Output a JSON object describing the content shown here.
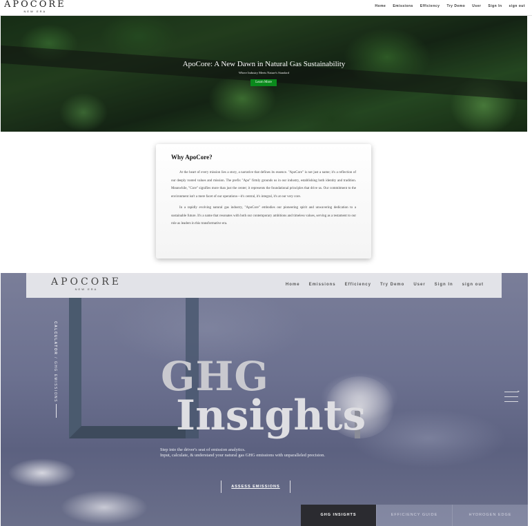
{
  "topnav": {
    "logo_main": "APOCORE",
    "logo_sub": "NEW ERA",
    "links": [
      "Home",
      "Emissions",
      "Efficiency",
      "Try Demo",
      "User",
      "Sign In",
      "sign out"
    ]
  },
  "hero": {
    "title": "ApoCore: A New Dawn in Natural Gas Sustainability",
    "tagline": "Where Industry Meets Nature's Standard",
    "button_label": "Learn More"
  },
  "about": {
    "heading": "Why ApoCore?",
    "paragraphs": [
      "At the heart of every mission lies a story, a narrative that defines its essence. \"ApoCore\" is not just a name; it's a reflection of our deeply rooted values and mission. The prefix \"Apo\" firmly grounds us in our industry, establishing both identity and tradition. Meanwhile, \"Core\" signifies more than just the center; it represents the foundational principles that drive us. Our commitment to the environment isn't a mere facet of our operations—it's central, it's integral, it's at our very core.",
      "In a rapidly evolving natural gas industry, \"ApoCore\" embodies our pioneering spirit and unwavering dedication to a sustainable future. It's a name that resonates with both our contemporary ambitions and timeless values, serving as a testament to our role as leaders in this transformative era."
    ]
  },
  "ghg": {
    "nav_logo_main": "APOCORE",
    "nav_logo_sub": "NEW ERA",
    "nav_links": [
      "Home",
      "Emissions",
      "Efficiency",
      "Try Demo",
      "User",
      "Sign In",
      "sign out"
    ],
    "vertical_bold": "CALCULATOR",
    "vertical_rest": " / GHG EMISSIONS",
    "title_line1": "GHG",
    "title_line2": "Insights",
    "desc_line1": "Step into the driver's seat of emission analytics.",
    "desc_line2": "Input, calculate, & understand your natural gas GHG emissions with unparalleled precision.",
    "cta_label": "ASSESS EMISSIONS",
    "tabs": [
      "GHG INSIGHTS",
      "EFFICIENCY GUIDE",
      "HYDROGEN EDGE"
    ],
    "active_tab": "GHG INSIGHTS"
  },
  "colors": {
    "hero_button": "#0a8a1c",
    "active_tab": "#2b2b30"
  }
}
